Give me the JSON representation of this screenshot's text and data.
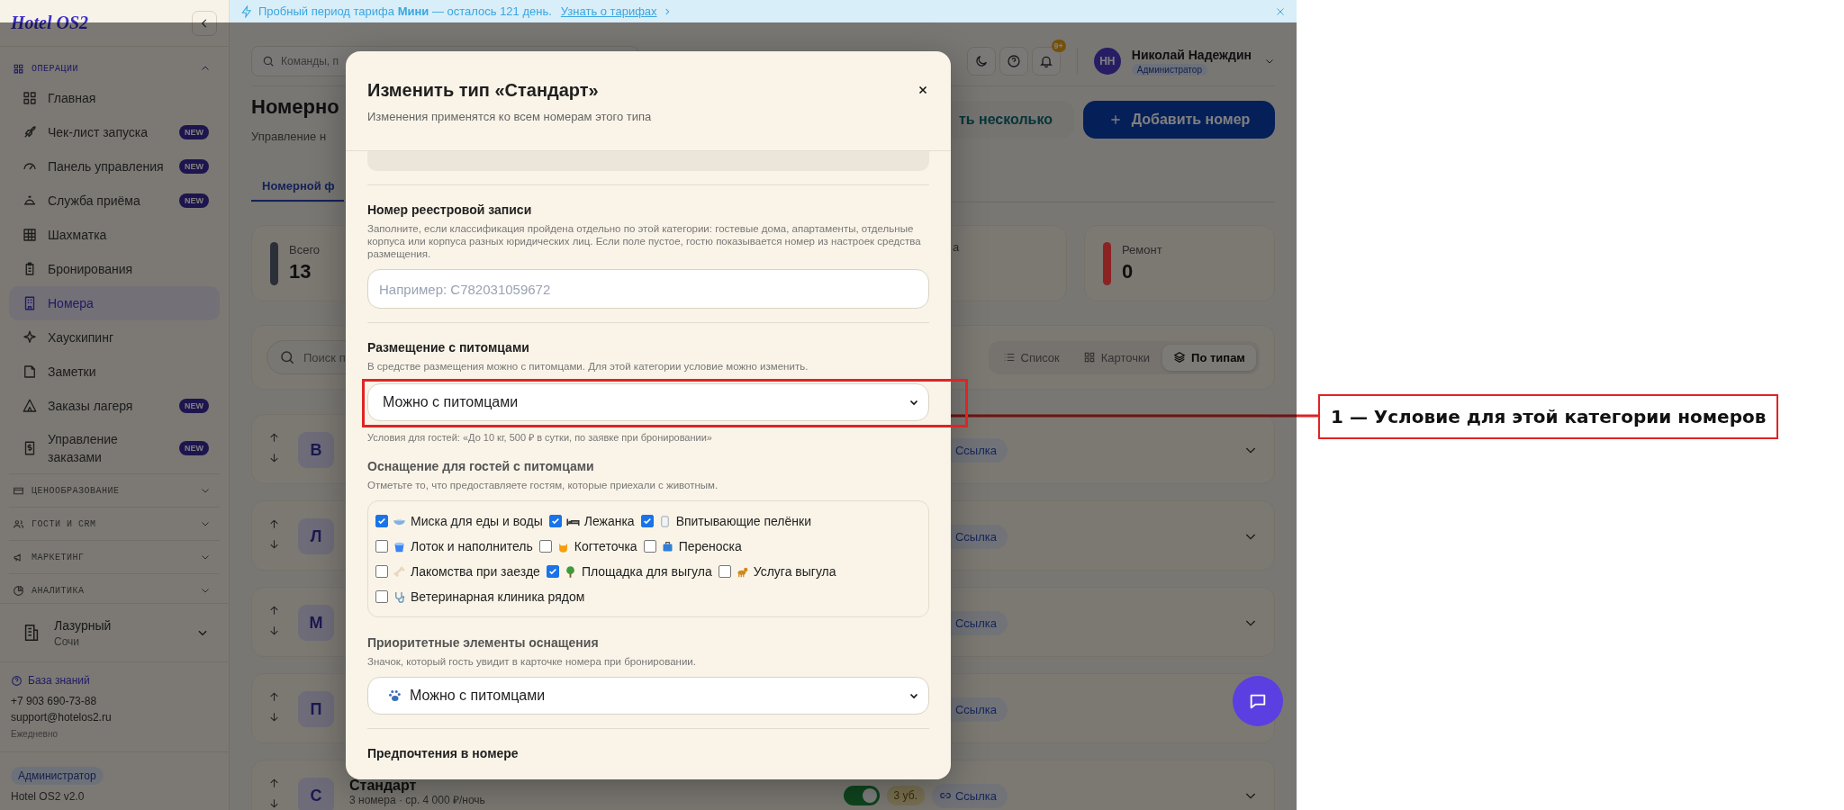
{
  "banner": {
    "text": "Пробный период тарифа **Мини** — осталось 121 день.",
    "link": "Узнать о тарифах"
  },
  "sidebar": {
    "logo": "Hotel OS2",
    "sections": [
      {
        "label": "ОПЕРАЦИИ",
        "expanded": true,
        "items": [
          {
            "label": "Главная",
            "selected": false
          },
          {
            "label": "Чек-лист запуска",
            "badge": "NEW",
            "selected": false
          },
          {
            "label": "Панель управления",
            "badge": "NEW",
            "selected": false
          },
          {
            "label": "Служба приёма",
            "badge": "NEW",
            "selected": false
          },
          {
            "label": "Шахматка",
            "selected": false
          },
          {
            "label": "Бронирования",
            "selected": false
          },
          {
            "label": "Номера",
            "selected": true
          },
          {
            "label": "Хаускипинг",
            "selected": false
          },
          {
            "label": "Заметки",
            "selected": false
          },
          {
            "label": "Заказы лагеря",
            "badge": "NEW",
            "selected": false
          },
          {
            "label": "Управление заказами",
            "badge": "NEW",
            "selected": false
          }
        ]
      },
      {
        "label": "ЦЕНООБРАЗОВАНИЕ",
        "expanded": false
      },
      {
        "label": "ГОСТИ И CRM",
        "expanded": false
      },
      {
        "label": "МАРКЕТИНГ",
        "expanded": false
      },
      {
        "label": "АНАЛИТИКА",
        "expanded": false
      }
    ],
    "property": {
      "name": "Лазурный",
      "city": "Сочи"
    },
    "help": {
      "link": "База знаний",
      "phone": "+7 903 690-73-88",
      "email": "support@hotelos2.ru",
      "hours": "Ежедневно"
    },
    "role": "Администратор",
    "version": "Hotel OS2 v2.0"
  },
  "header": {
    "search_placeholder": "Команды, п",
    "notifications": "9+",
    "user": {
      "initials": "НН",
      "name": "Николай Надеждин",
      "role": "Администратор"
    }
  },
  "page": {
    "title": "Номерно",
    "subtitle": "Управление н",
    "buttons": [
      "ть несколько",
      "Добавить номер"
    ],
    "tab": "Номерной ф",
    "stats": [
      {
        "label": "Всего",
        "value": "13",
        "color": "#2b2f38"
      },
      {
        "label": "а"
      },
      {
        "label": "Ремонт",
        "value": "0",
        "color": "#8b2323"
      }
    ],
    "search_placeholder": "Поиск п",
    "views": [
      {
        "label": "Список",
        "selected": false
      },
      {
        "label": "Карточки",
        "selected": false
      },
      {
        "label": "По типам",
        "selected": true
      }
    ],
    "rows": [
      {
        "letter": "В",
        "link": "Ссылка"
      },
      {
        "letter": "Л",
        "link": "Ссылка"
      },
      {
        "letter": "М",
        "link": "Ссылка"
      },
      {
        "letter": "П",
        "link": "Ссылка"
      },
      {
        "letter": "С",
        "name": "Стандарт",
        "summary": "3 номера · ср. 4 000 ₽/ночь",
        "on": true,
        "count": "3 уб.",
        "link": "Ссылка"
      }
    ]
  },
  "modal": {
    "title": "Изменить тип «Стандарт»",
    "subtitle": "Изменения применятся ко всем номерам этого типа",
    "registry": {
      "label": "Номер реестровой записи",
      "hint": "Заполните, если классификация пройдена отдельно по этой категории: гостевые дома, апартаменты, отдельные корпуса или корпуса разных юридических лиц. Если поле пустое, гостю показывается номер из настроек средства размещения.",
      "placeholder": "Например: С782031059672"
    },
    "pets": {
      "label": "Размещение с питомцами",
      "hint": "В средстве размещения можно с питомцами. Для этой категории условие можно изменить.",
      "value": "Можно с питомцами",
      "note": "Условия для гостей: «До 10 кг, 500 ₽ в сутки, по заявке при бронировании»"
    },
    "amenities": {
      "label": "Оснащение для гостей с питомцами",
      "hint": "Отметьте то, что предоставляете гостям, которые приехали с животным.",
      "items": [
        {
          "label": "Миска для еды и воды",
          "checked": true
        },
        {
          "label": "Лежанка",
          "checked": true
        },
        {
          "label": "Впитывающие пелёнки",
          "checked": true
        },
        {
          "label": "Лоток и наполнитель",
          "checked": false
        },
        {
          "label": "Когтеточка",
          "checked": false
        },
        {
          "label": "Переноска",
          "checked": false
        },
        {
          "label": "Лакомства при заезде",
          "checked": false
        },
        {
          "label": "Площадка для выгула",
          "checked": true
        },
        {
          "label": "Услуга выгула",
          "checked": false
        },
        {
          "label": "Ветеринарная клиника рядом",
          "checked": false
        }
      ]
    },
    "priority": {
      "label": "Приоритетные элементы оснащения",
      "hint": "Значок, который гость увидит в карточке номера при бронировании.",
      "value": "Можно с питомцами"
    },
    "preferences": {
      "label": "Предпочтения в номере"
    }
  },
  "annotation": {
    "label": "1 — Условие для этой категории номеров"
  }
}
